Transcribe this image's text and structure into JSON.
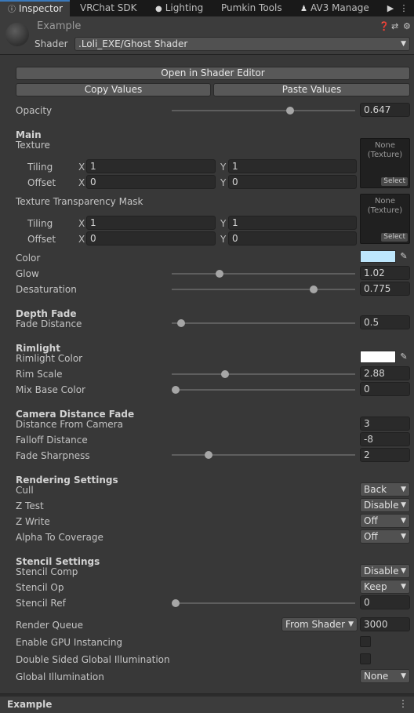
{
  "tabs": [
    {
      "label": "Inspector",
      "icon": "info-icon",
      "active": true
    },
    {
      "label": "VRChat SDK"
    },
    {
      "label": "Lighting",
      "icon": "bulb-icon"
    },
    {
      "label": "Pumkin Tools"
    },
    {
      "label": "AV3 Manage",
      "icon": "avatar-icon"
    }
  ],
  "header": {
    "material_name": "Example",
    "shader_label": "Shader",
    "shader_value": ".Loli_EXE/Ghost Shader"
  },
  "buttons": {
    "open_shader_editor": "Open in Shader Editor",
    "copy_values": "Copy Values",
    "paste_values": "Paste Values"
  },
  "props": {
    "opacity": {
      "label": "Opacity",
      "value": "0.647",
      "fraction": 0.647
    },
    "main": {
      "header": "Main",
      "texture": {
        "label": "Texture",
        "none": "None",
        "type": "(Texture)",
        "select": "Select"
      },
      "tiling": {
        "label": "Tiling",
        "x": "1",
        "y": "1"
      },
      "offset": {
        "label": "Offset",
        "x": "0",
        "y": "0"
      },
      "mask": {
        "label": "Texture Transparency Mask",
        "none": "None",
        "type": "(Texture)",
        "select": "Select"
      },
      "mask_tiling": {
        "label": "Tiling",
        "x": "1",
        "y": "1"
      },
      "mask_offset": {
        "label": "Offset",
        "x": "0",
        "y": "0"
      },
      "axis_x": "X",
      "axis_y": "Y",
      "color": {
        "label": "Color",
        "hex": "#bde6fc"
      },
      "glow": {
        "label": "Glow",
        "value": "1.02",
        "fraction": 0.26
      },
      "desaturation": {
        "label": "Desaturation",
        "value": "0.775",
        "fraction": 0.775
      }
    },
    "depth_fade": {
      "header": "Depth Fade",
      "fade_distance": {
        "label": "Fade Distance",
        "value": "0.5",
        "fraction": 0.05
      }
    },
    "rimlight": {
      "header": "Rimlight",
      "rim_color": {
        "label": "Rimlight Color",
        "hex": "#ffffff"
      },
      "rim_scale": {
        "label": "Rim Scale",
        "value": "2.88",
        "fraction": 0.29
      },
      "mix_base_color": {
        "label": "Mix Base Color",
        "value": "0",
        "fraction": 0
      }
    },
    "camera_fade": {
      "header": "Camera Distance Fade",
      "distance": {
        "label": "Distance From Camera",
        "value": "3"
      },
      "falloff": {
        "label": "Falloff Distance",
        "value": "-8"
      },
      "sharpness": {
        "label": "Fade Sharpness",
        "value": "2",
        "fraction": 0.2
      }
    },
    "rendering": {
      "header": "Rendering Settings",
      "cull": {
        "label": "Cull",
        "value": "Back"
      },
      "ztest": {
        "label": "Z Test",
        "value": "Disabled"
      },
      "zwrite": {
        "label": "Z Write",
        "value": "Off"
      },
      "alpha_to_coverage": {
        "label": "Alpha To Coverage",
        "value": "Off"
      }
    },
    "stencil": {
      "header": "Stencil Settings",
      "comp": {
        "label": "Stencil Comp",
        "value": "Disabled"
      },
      "op": {
        "label": "Stencil Op",
        "value": "Keep"
      },
      "ref": {
        "label": "Stencil Ref",
        "value": "0",
        "fraction": 0
      }
    },
    "render_queue": {
      "label": "Render Queue",
      "source": "From Shader",
      "value": "3000"
    },
    "gpu_instancing": {
      "label": "Enable GPU Instancing",
      "checked": false
    },
    "double_sided_gi": {
      "label": "Double Sided Global Illumination",
      "checked": false
    },
    "global_illumination": {
      "label": "Global Illumination",
      "value": "None"
    }
  },
  "footer": {
    "title": "Example"
  },
  "colors": {
    "accent": "#3a79bb",
    "panel": "#383838"
  }
}
